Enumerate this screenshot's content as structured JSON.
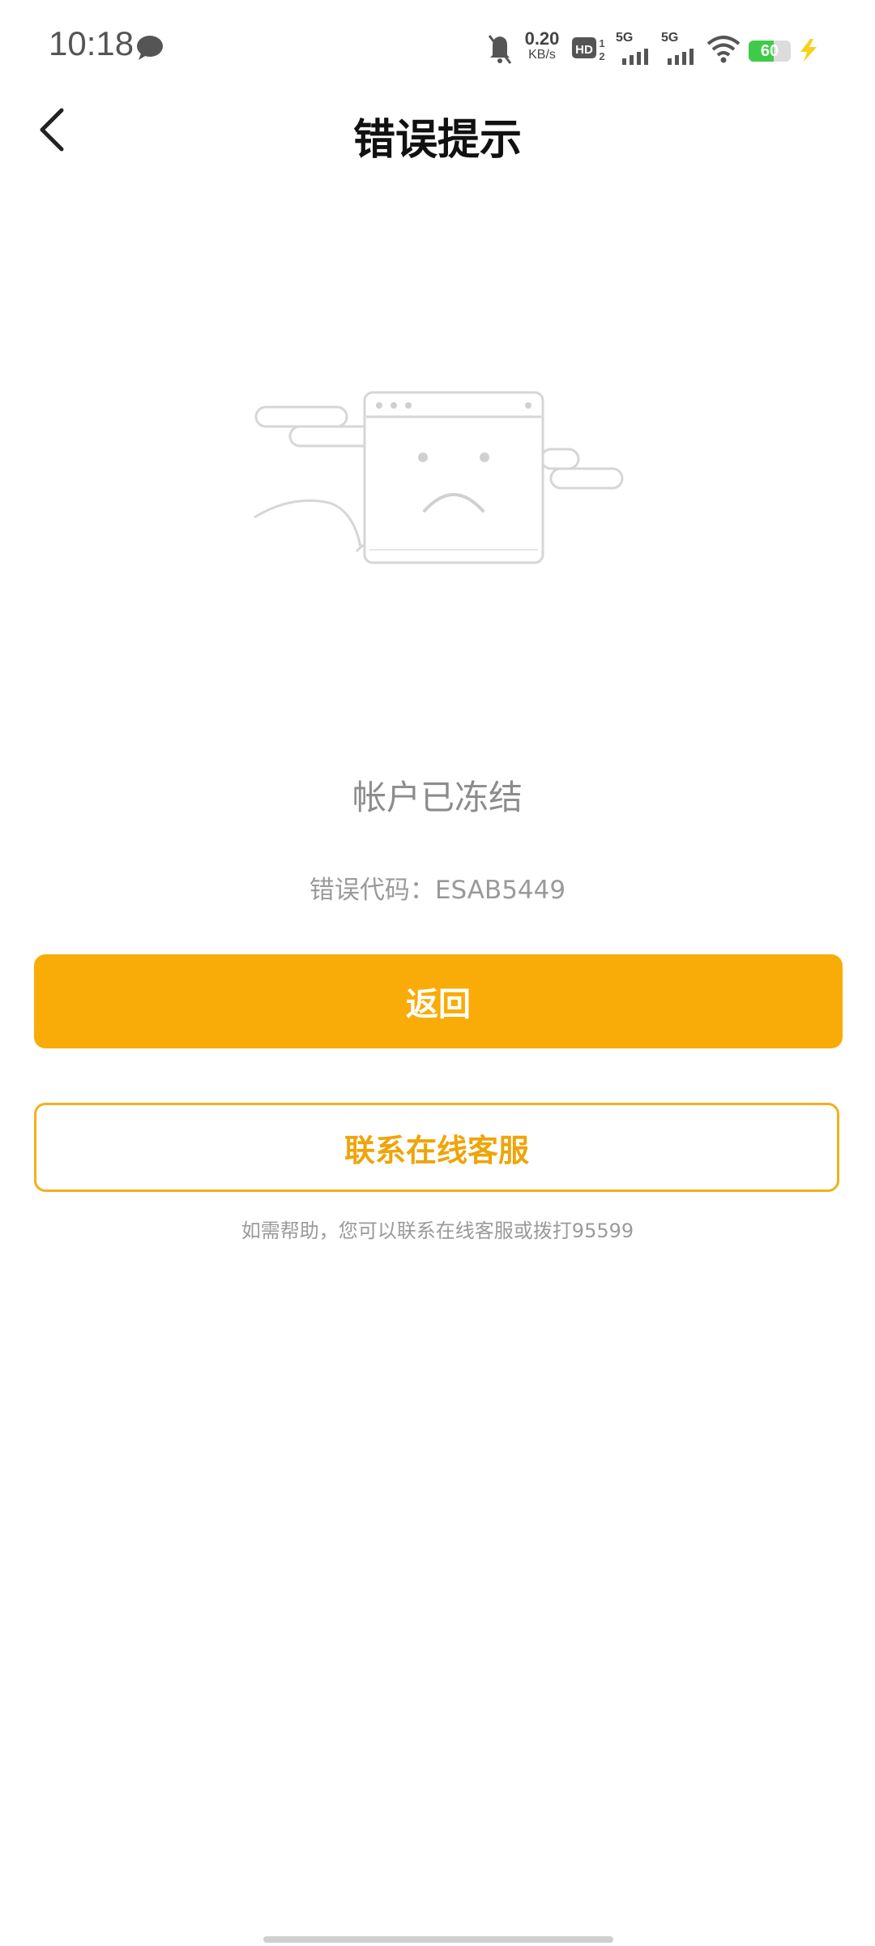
{
  "status_bar": {
    "time": "10:18",
    "net_speed_value": "0.20",
    "net_speed_unit": "KB/s",
    "hd_label": "HD",
    "sim1_label": "5G",
    "sim2_label": "5G",
    "battery_level": "60",
    "battery_fraction": 0.6
  },
  "nav": {
    "title": "错误提示"
  },
  "error": {
    "title": "帐户已冻结",
    "code": "错误代码：ESAB5449"
  },
  "buttons": {
    "return_label": "返回",
    "contact_label": "联系在线客服"
  },
  "help_text": "如需帮助，您可以联系在线客服或拨打95599",
  "colors": {
    "accent": "#f9ab07",
    "outline": "#f2b01c",
    "battery_green": "#3fcb4a"
  }
}
